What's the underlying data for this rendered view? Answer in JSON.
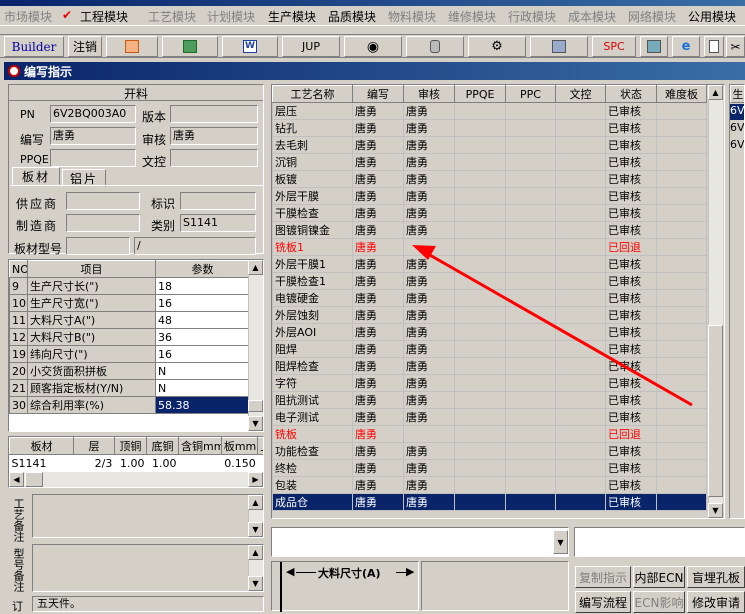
{
  "modules": [
    {
      "label": "市场模块",
      "active": false
    },
    {
      "label": "工程模块",
      "active": true
    },
    {
      "label": "工艺模块",
      "active": false
    },
    {
      "label": "计划模块",
      "active": false
    },
    {
      "label": "生产模块",
      "active": true
    },
    {
      "label": "品质模块",
      "active": true
    },
    {
      "label": "物料模块",
      "active": false
    },
    {
      "label": "维修模块",
      "active": false
    },
    {
      "label": "行政模块",
      "active": false
    },
    {
      "label": "成本模块",
      "active": false
    },
    {
      "label": "网络模块",
      "active": false
    },
    {
      "label": "公用模块",
      "active": true
    }
  ],
  "toolbar": {
    "builder": "Builder",
    "logout": "注销",
    "jup": "JUP",
    "spc": "SPC"
  },
  "window_title": "编写指示",
  "kailiao": {
    "header": "开料",
    "pn_label": "PN",
    "pn": "6V2BQ003A0",
    "version_label": "版本",
    "version": "",
    "writer_label": "编写",
    "writer": "唐勇",
    "reviewer_label": "审核",
    "reviewer": "唐勇",
    "ppqe_label": "PPQE",
    "ppqe": "",
    "control_label": "文控",
    "control": ""
  },
  "material_tabs": [
    "板材",
    "铝片"
  ],
  "material": {
    "supplier_label": "供应商",
    "supplier": "",
    "mark_label": "标识",
    "mark": "",
    "maker_label": "制造商",
    "maker": "",
    "category_label": "类别",
    "category": "S1141",
    "model_label": "板材型号",
    "model": "",
    "model2": "/"
  },
  "param_table": {
    "headers": [
      "NO",
      "项目",
      "参数"
    ],
    "rows": [
      {
        "no": "9",
        "item": "生产尺寸长(\")",
        "value": "18"
      },
      {
        "no": "10",
        "item": "生产尺寸宽(\")",
        "value": "16"
      },
      {
        "no": "11",
        "item": "大料尺寸A(\")",
        "value": "48"
      },
      {
        "no": "12",
        "item": "大料尺寸B(\")",
        "value": "36"
      },
      {
        "no": "19",
        "item": "纬向尺寸(\")",
        "value": "16"
      },
      {
        "no": "20",
        "item": "小交货面积拼板",
        "value": "N"
      },
      {
        "no": "21",
        "item": "顾客指定板材(Y/N)",
        "value": "N"
      },
      {
        "no": "30",
        "item": "综合利用率(%)",
        "value": "58.38"
      }
    ]
  },
  "board_table": {
    "headers": [
      "板材",
      "层",
      "顶铜",
      "底铜",
      "含铜mm",
      "板mm",
      "上"
    ],
    "row": [
      "S1141",
      "2/3",
      "1.00",
      "1.00",
      "",
      "0.150",
      ""
    ]
  },
  "remarks": {
    "process_label": "工艺备注",
    "model_label": "型号备注",
    "order_label": "订",
    "order_text": "五天件。"
  },
  "process_table": {
    "headers": [
      "工艺名称",
      "编写",
      "审核",
      "PPQE",
      "PPC",
      "文控",
      "状态",
      "难度板"
    ],
    "rows": [
      {
        "name": "层压",
        "writer": "唐勇",
        "reviewer": "唐勇",
        "status": "已审核",
        "red": false,
        "selected": false
      },
      {
        "name": "钻孔",
        "writer": "唐勇",
        "reviewer": "唐勇",
        "status": "已审核",
        "red": false,
        "selected": false
      },
      {
        "name": "去毛刺",
        "writer": "唐勇",
        "reviewer": "唐勇",
        "status": "已审核",
        "red": false,
        "selected": false
      },
      {
        "name": "沉铜",
        "writer": "唐勇",
        "reviewer": "唐勇",
        "status": "已审核",
        "red": false,
        "selected": false
      },
      {
        "name": "板镀",
        "writer": "唐勇",
        "reviewer": "唐勇",
        "status": "已审核",
        "red": false,
        "selected": false
      },
      {
        "name": "外层干膜",
        "writer": "唐勇",
        "reviewer": "唐勇",
        "status": "已审核",
        "red": false,
        "selected": false
      },
      {
        "name": "干膜检查",
        "writer": "唐勇",
        "reviewer": "唐勇",
        "status": "已审核",
        "red": false,
        "selected": false
      },
      {
        "name": "图镀铜镍金",
        "writer": "唐勇",
        "reviewer": "唐勇",
        "status": "已审核",
        "red": false,
        "selected": false
      },
      {
        "name": "铣板1",
        "writer": "唐勇",
        "reviewer": "",
        "status": "已回退",
        "red": true,
        "selected": false
      },
      {
        "name": "外层干膜1",
        "writer": "唐勇",
        "reviewer": "唐勇",
        "status": "已审核",
        "red": false,
        "selected": false
      },
      {
        "name": "干膜检查1",
        "writer": "唐勇",
        "reviewer": "唐勇",
        "status": "已审核",
        "red": false,
        "selected": false
      },
      {
        "name": "电镀硬金",
        "writer": "唐勇",
        "reviewer": "唐勇",
        "status": "已审核",
        "red": false,
        "selected": false
      },
      {
        "name": "外层蚀刻",
        "writer": "唐勇",
        "reviewer": "唐勇",
        "status": "已审核",
        "red": false,
        "selected": false
      },
      {
        "name": "外层AOI",
        "writer": "唐勇",
        "reviewer": "唐勇",
        "status": "已审核",
        "red": false,
        "selected": false
      },
      {
        "name": "阻焊",
        "writer": "唐勇",
        "reviewer": "唐勇",
        "status": "已审核",
        "red": false,
        "selected": false
      },
      {
        "name": "阻焊检查",
        "writer": "唐勇",
        "reviewer": "唐勇",
        "status": "已审核",
        "red": false,
        "selected": false
      },
      {
        "name": "字符",
        "writer": "唐勇",
        "reviewer": "唐勇",
        "status": "已审核",
        "red": false,
        "selected": false
      },
      {
        "name": "阻抗测试",
        "writer": "唐勇",
        "reviewer": "唐勇",
        "status": "已审核",
        "red": false,
        "selected": false
      },
      {
        "name": "电子测试",
        "writer": "唐勇",
        "reviewer": "唐勇",
        "status": "已审核",
        "red": false,
        "selected": false
      },
      {
        "name": "铣板",
        "writer": "唐勇",
        "reviewer": "",
        "status": "已回退",
        "red": true,
        "selected": false
      },
      {
        "name": "功能检查",
        "writer": "唐勇",
        "reviewer": "唐勇",
        "status": "已审核",
        "red": false,
        "selected": false
      },
      {
        "name": "终检",
        "writer": "唐勇",
        "reviewer": "唐勇",
        "status": "已审核",
        "red": false,
        "selected": false
      },
      {
        "name": "包装",
        "writer": "唐勇",
        "reviewer": "唐勇",
        "status": "已审核",
        "red": false,
        "selected": false
      },
      {
        "name": "成品仓",
        "writer": "唐勇",
        "reviewer": "唐勇",
        "status": "已审核",
        "red": false,
        "selected": true
      }
    ]
  },
  "right_list": {
    "header": "生",
    "items": [
      "6V",
      "6V",
      "6V"
    ]
  },
  "diagram": {
    "label": "大料尺寸(A)"
  },
  "buttons": {
    "copy": "复制指示",
    "internal_ecn": "内部ECN",
    "blind_hole": "盲埋孔板",
    "write_flow": "编写流程",
    "ecn_effect": "ECN影响",
    "modify_review": "修改审请"
  },
  "colors": {
    "selected_bg": "#0a246a",
    "red_text": "#ff0000",
    "annotation": "#ff0000"
  }
}
